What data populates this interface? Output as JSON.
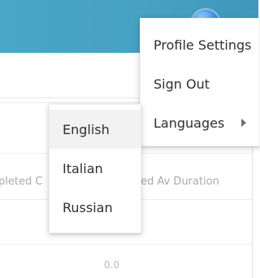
{
  "header": {
    "brand_color": "#46a1c3"
  },
  "table": {
    "columns": [
      {
        "label": "pleted C"
      },
      {
        "label": "eted Av Duration"
      }
    ],
    "values": [
      "0.0"
    ]
  },
  "profile_menu": {
    "items": [
      {
        "label": "Profile Settings"
      },
      {
        "label": "Sign Out"
      },
      {
        "label": "Languages",
        "icon": "chevron-right-icon"
      }
    ]
  },
  "languages_menu": {
    "items": [
      {
        "label": "English",
        "selected": true
      },
      {
        "label": "Italian",
        "selected": false
      },
      {
        "label": "Russian",
        "selected": false
      }
    ]
  }
}
